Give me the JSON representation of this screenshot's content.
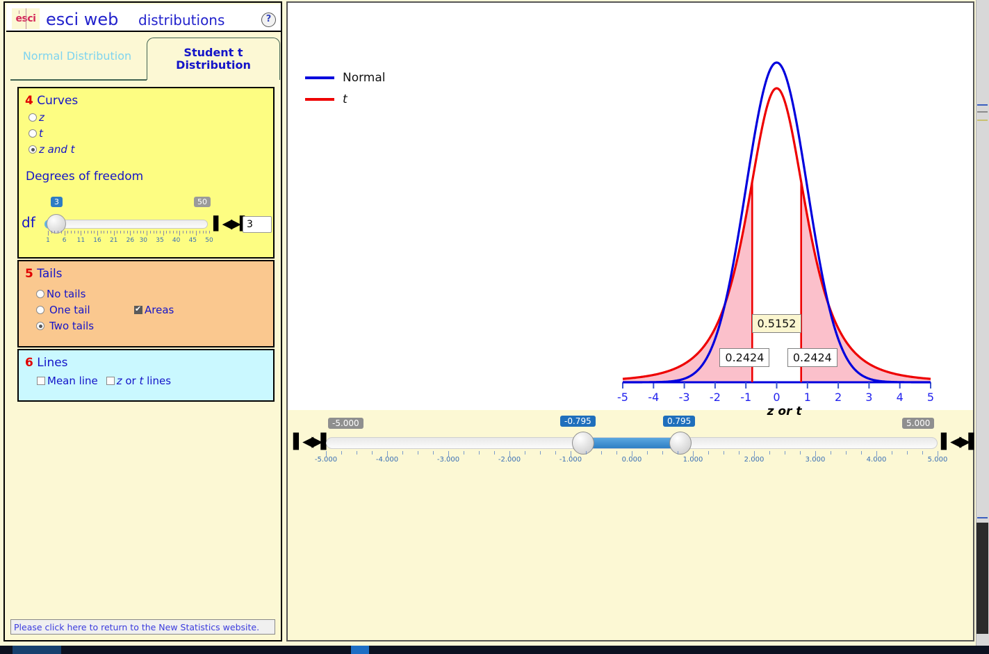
{
  "header": {
    "logo": "esci",
    "title_1": "esci web",
    "title_2": "distributions",
    "help": "?"
  },
  "tabs": [
    {
      "label": "Normal Distribution",
      "active": false
    },
    {
      "label": "Student t Distribution",
      "line1": "Student t",
      "line2": "Distribution",
      "active": true
    }
  ],
  "curves_panel": {
    "number": "4",
    "title": "Curves",
    "options": [
      {
        "label": "z",
        "selected": false
      },
      {
        "label": "t",
        "selected": false
      },
      {
        "label": "z and t",
        "selected": true
      }
    ],
    "df_heading": "Degrees of freedom",
    "df_axis_label": "df",
    "df_min_badge": "3",
    "df_max_badge": "50",
    "df_value": "3",
    "df_ticks": [
      "1",
      "6",
      "11",
      "16",
      "21",
      "26",
      "30",
      "35",
      "40",
      "45",
      "50"
    ],
    "df_range_min": 1,
    "df_range_max": 50
  },
  "tails_panel": {
    "number": "5",
    "title": "Tails",
    "options": [
      {
        "label": "No tails",
        "selected": false
      },
      {
        "label": "One tail",
        "selected": false
      },
      {
        "label": "Two tails",
        "selected": true
      }
    ],
    "areas_label": "Areas",
    "areas_checked": true
  },
  "lines_panel": {
    "number": "6",
    "title": "Lines",
    "options": [
      {
        "label": "Mean line",
        "checked": false
      },
      {
        "label": "z or t lines",
        "checked": false
      }
    ]
  },
  "footer": {
    "link": "Please click here to return to the New Statistics website."
  },
  "chart_data": {
    "type": "line",
    "title": "",
    "xlabel": "z or t",
    "ylabel": "",
    "xlim": [
      -5,
      5
    ],
    "xticks": [
      -5,
      -4,
      -3,
      -2,
      -1,
      0,
      1,
      2,
      3,
      4,
      5
    ],
    "xticklabels": [
      "-5",
      "-4",
      "-3",
      "-2",
      "-1",
      "0",
      "1",
      "2",
      "3",
      "4",
      "5"
    ],
    "grid": false,
    "legend_position": "top-left",
    "series": [
      {
        "name": "Normal",
        "color": "#0000dd",
        "kind": "normal",
        "df": null,
        "peak_y": 0.3989
      },
      {
        "name": "t",
        "color": "#ee0000",
        "kind": "student-t",
        "df": 3,
        "peak_y": 0.3676
      }
    ],
    "shaded_regions": [
      {
        "name": "lower-tail",
        "from": -5,
        "to": -0.795,
        "area": "0.2424",
        "fill": "#fbc0cb"
      },
      {
        "name": "central",
        "from": -0.795,
        "to": 0.795,
        "area": "0.5152",
        "fill": "none"
      },
      {
        "name": "upper-tail",
        "from": 0.795,
        "to": 5,
        "area": "0.2424",
        "fill": "#fbc0cb"
      }
    ],
    "annotations": [
      {
        "name": "left-area-value",
        "text": "0.2424",
        "x": -0.95
      },
      {
        "name": "central-area-value",
        "text": "0.5152",
        "x": 0.0
      },
      {
        "name": "right-area-value",
        "text": "0.2424",
        "x": 1.25
      }
    ],
    "cut_lines": [
      -0.795,
      0.795
    ]
  },
  "range_slider": {
    "min_badge": "-5.000",
    "max_badge": "5.000",
    "low_badge": "-0.795",
    "high_badge": "0.795",
    "low_value": -0.795,
    "high_value": 0.795,
    "range_min": -5,
    "range_max": 5,
    "ticklabels": [
      "-5.000",
      "-4.000",
      "-3.000",
      "-2.000",
      "-1.000",
      "0.000",
      "1.000",
      "2.000",
      "3.000",
      "4.000",
      "5.000"
    ]
  },
  "colors": {
    "normal": "#0000dd",
    "t": "#ee0000",
    "fill": "#fbc0cb",
    "panel_curves": "#fdfd82",
    "panel_tails": "#fac88f",
    "panel_lines": "#caf8ff",
    "app_bg": "#fcf8d4",
    "label_blue": "#1414c8",
    "number_red": "#e00000"
  }
}
